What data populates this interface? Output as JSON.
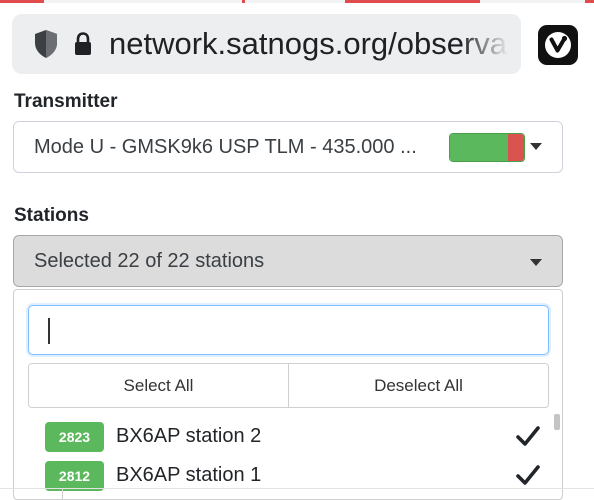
{
  "browser": {
    "url": "network.satnogs.org/observat",
    "icons": [
      "shield-icon",
      "lock-icon",
      "vivaldi-icon"
    ],
    "accent_top_strip": "#e04b4b"
  },
  "form": {
    "transmitter": {
      "label": "Transmitter",
      "selected_value": "Mode U - GMSK9k6 USP TLM - 435.000 ...",
      "status_fraction": 0.78,
      "status_colors": {
        "good": "#5cb85c",
        "bad": "#d9534f"
      }
    },
    "stations": {
      "label": "Stations",
      "selected_summary": "Selected 22 of 22 stations",
      "dropdown": {
        "search_value": "",
        "select_all_label": "Select All",
        "deselect_all_label": "Deselect All",
        "items": [
          {
            "id": "2823",
            "name": "BX6AP station 2",
            "checked": true
          },
          {
            "id": "2812",
            "name": "BX6AP station 1",
            "checked": true
          }
        ]
      }
    }
  },
  "colors": {
    "badge": "#5cb85c",
    "focus_border": "#80bdff"
  }
}
